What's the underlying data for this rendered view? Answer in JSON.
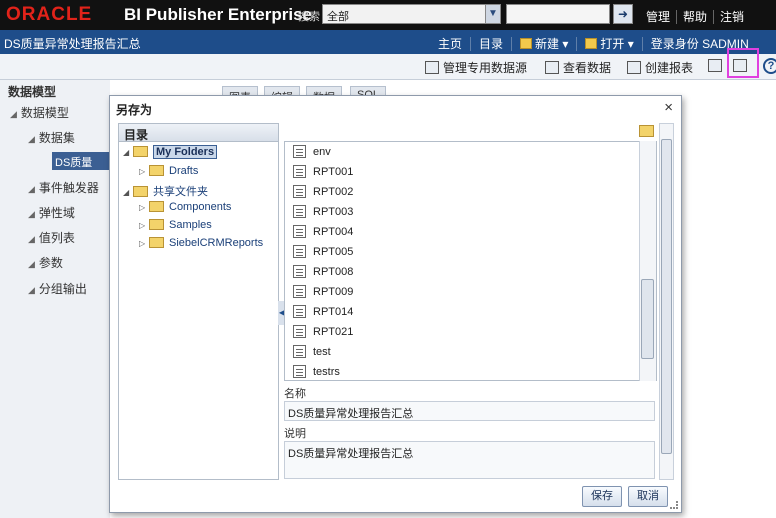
{
  "topbar": {
    "logo": "ORACLE",
    "product": "BI Publisher Enterprise",
    "search_label": "搜索",
    "search_scope": "全部",
    "links": [
      "管理",
      "帮助",
      "注销"
    ]
  },
  "secbar": {
    "doc_title": "DS质量异常处理报告汇总",
    "links": [
      "主页",
      "目录",
      "新建",
      "打开",
      "登录身份 SADMIN"
    ]
  },
  "toolbar": {
    "manage_ds": "管理专用数据源",
    "view_data": "查看数据",
    "create_report": "创建报表"
  },
  "left_panel": {
    "header": "数据模型",
    "items": [
      "数据模型",
      "数据集",
      "DS质量",
      "事件触发器",
      "弹性域",
      "值列表",
      "参数",
      "分组输出"
    ]
  },
  "bg_tabs": [
    "图表",
    "编辑",
    "数据",
    "SQL"
  ],
  "dialog": {
    "title": "另存为",
    "close": "×",
    "tree_header": "目录",
    "tree": [
      "My Folders",
      "Drafts",
      "共享文件夹",
      "Components",
      "Samples",
      "SiebelCRMReports"
    ],
    "list_items": [
      "env",
      "RPT001",
      "RPT002",
      "RPT003",
      "RPT004",
      "RPT005",
      "RPT008",
      "RPT009",
      "RPT014",
      "RPT021",
      "test",
      "testrs"
    ],
    "name_label": "名称",
    "name_value": "DS质量异常处理报告汇总",
    "desc_label": "说明",
    "desc_value": "DS质量异常处理报告汇总",
    "save": "保存",
    "cancel": "取消"
  }
}
